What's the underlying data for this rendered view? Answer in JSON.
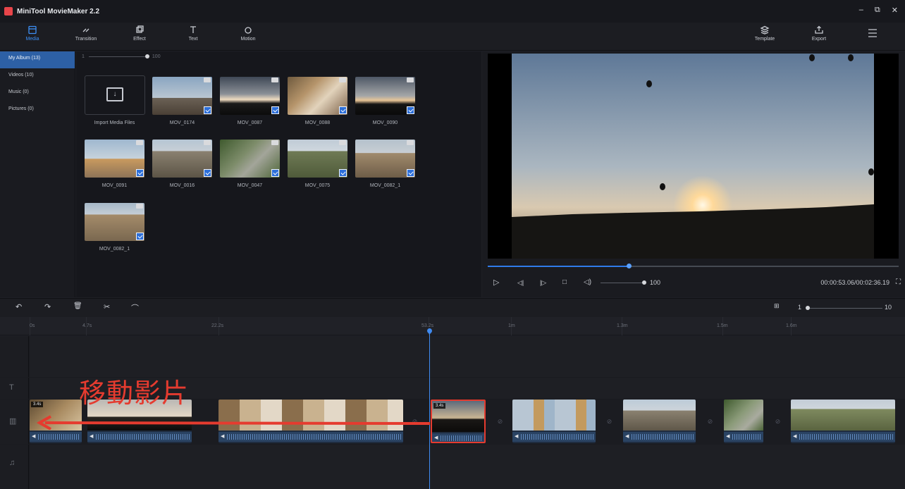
{
  "app": {
    "title": "MiniTool MovieMaker 2.2"
  },
  "window": {
    "minimize": "–",
    "restore": "⧉",
    "close": "✕"
  },
  "toolbar": {
    "tabs": [
      {
        "label": "Media",
        "icon": "media-folder-icon",
        "active": true
      },
      {
        "label": "Transition",
        "icon": "transition-icon"
      },
      {
        "label": "Effect",
        "icon": "effect-icon"
      },
      {
        "label": "Text",
        "icon": "text-icon"
      },
      {
        "label": "Motion",
        "icon": "motion-icon"
      }
    ],
    "right": [
      {
        "label": "Template",
        "icon": "template-icon"
      },
      {
        "label": "Export",
        "icon": "export-icon"
      }
    ],
    "menu_icon": "hamburger-menu-icon"
  },
  "sidebar": {
    "items": [
      {
        "label": "My Album  (13)",
        "active": true
      },
      {
        "label": "Videos  (10)"
      },
      {
        "label": "Music  (0)"
      },
      {
        "label": "Pictures  (0)"
      }
    ]
  },
  "media": {
    "zoom_min": "1",
    "zoom_max": "100",
    "zoom_value": 1.0,
    "import_label": "Import Media Files",
    "files": [
      {
        "name": "MOV_0174"
      },
      {
        "name": "MOV_0087"
      },
      {
        "name": "MOV_0088"
      },
      {
        "name": "MOV_0090"
      },
      {
        "name": "MOV_0091"
      },
      {
        "name": "MOV_0016"
      },
      {
        "name": "MOV_0047"
      },
      {
        "name": "MOV_0075"
      },
      {
        "name": "MOV_0082_1"
      },
      {
        "name": "MOV_0082_1"
      }
    ]
  },
  "player": {
    "progress": 0.343,
    "volume": "100",
    "timecode": "00:00:53.06/00:02:36.19",
    "buttons": [
      "play",
      "previous-frame",
      "next-frame",
      "stop",
      "volume"
    ]
  },
  "timeline": {
    "toolbar": {
      "undo": "↶",
      "redo": "↷",
      "delete": "🗑",
      "cut": "✂",
      "audio": "⌒"
    },
    "zoom_min": "1",
    "zoom_max": "10",
    "zoom_value": 0.0,
    "ruler": [
      "0s",
      "4.7s",
      "22.2s",
      "53.2s",
      "1m",
      "1.3m",
      "1.5m",
      "1.6m"
    ],
    "clips": [
      {
        "duration": "3.4s",
        "selected": false
      },
      {
        "duration": "",
        "selected": false
      },
      {
        "duration": "",
        "selected": false
      },
      {
        "duration": "3.4s",
        "selected": true
      },
      {
        "duration": "",
        "selected": false
      },
      {
        "duration": "",
        "selected": false
      },
      {
        "duration": "",
        "selected": false
      },
      {
        "duration": "",
        "selected": false
      }
    ],
    "annotation": "移動影片"
  },
  "colors": {
    "accent": "#3d8ff5",
    "annotation": "#e53b2f",
    "panel": "#1e1f25"
  }
}
